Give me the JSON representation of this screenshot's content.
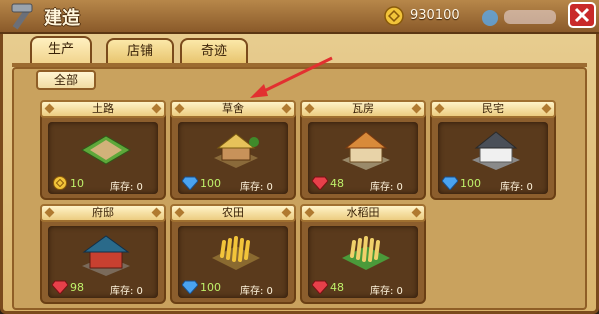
{
  "window": {
    "title": "建造",
    "currency": {
      "icon": "gold-coin-icon",
      "value": "930100"
    }
  },
  "tabs": [
    {
      "label": "生产",
      "active": true
    },
    {
      "label": "店铺",
      "active": false
    },
    {
      "label": "奇迹",
      "active": false
    }
  ],
  "subtab": {
    "label": "全部"
  },
  "stock_label": "库存: 0",
  "buildings": [
    {
      "name": "土路",
      "cost": "10",
      "resource": "gold-coin-icon"
    },
    {
      "name": "草舍",
      "cost": "100",
      "resource": "blue-gem-icon"
    },
    {
      "name": "瓦房",
      "cost": "48",
      "resource": "red-gem-icon"
    },
    {
      "name": "民宅",
      "cost": "100",
      "resource": "blue-gem-icon"
    },
    {
      "name": "府邸",
      "cost": "98",
      "resource": "red-gem-icon"
    },
    {
      "name": "农田",
      "cost": "100",
      "resource": "blue-gem-icon"
    },
    {
      "name": "水稻田",
      "cost": "48",
      "resource": "red-gem-icon"
    }
  ],
  "colors": {
    "red_arrow": "#e23030",
    "frame": "#7a4a1c",
    "value_green": "#bff06a"
  }
}
